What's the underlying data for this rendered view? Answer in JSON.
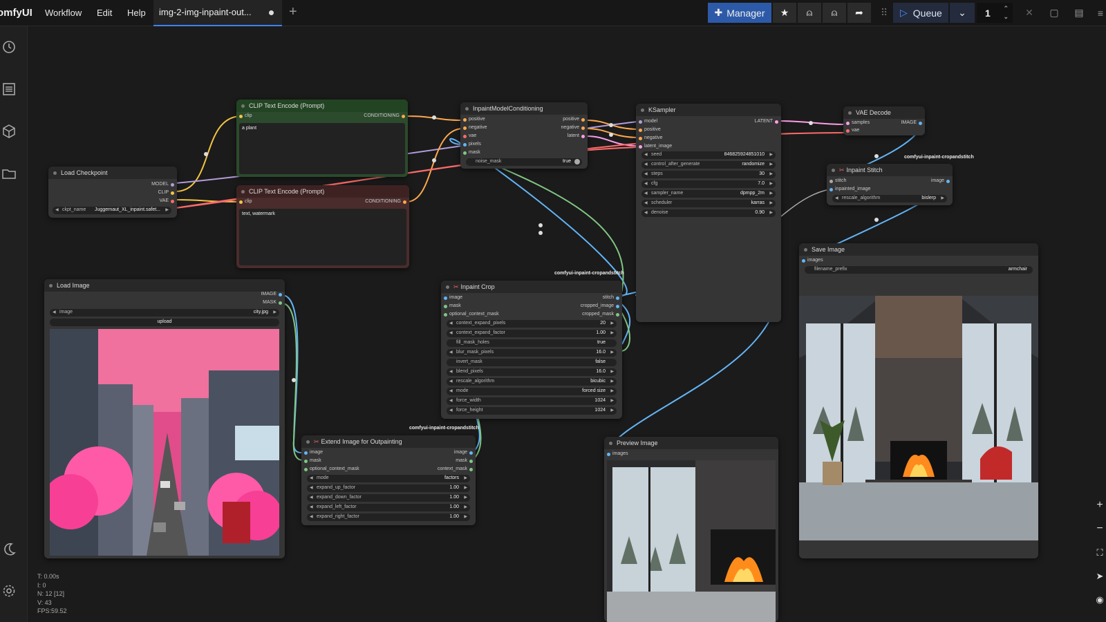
{
  "topbar": {
    "logo": "omfyUI",
    "menu": [
      "Workflow",
      "Edit",
      "Help"
    ],
    "tab_title": "img-2-img-inpaint-out...",
    "manager_label": "Manager",
    "queue_label": "Queue",
    "queue_count": "1"
  },
  "nodes": {
    "clip_pos": {
      "title": "CLIP Text Encode (Prompt)",
      "in": "clip",
      "out": "CONDITIONING",
      "text": "a plant"
    },
    "clip_neg": {
      "title": "CLIP Text Encode (Prompt)",
      "in": "clip",
      "out": "CONDITIONING",
      "text": "text, watermark"
    },
    "checkpoint": {
      "title": "Load Checkpoint",
      "outs": [
        "MODEL",
        "CLIP",
        "VAE"
      ],
      "w_label": "ckpt_name",
      "w_value": "Juggernaut_XL_inpaint.safet..."
    },
    "inpaint_cond": {
      "title": "InpaintModelConditioning",
      "ins": [
        "positive",
        "negative",
        "vae",
        "pixels",
        "mask"
      ],
      "outs": [
        "positive",
        "negative",
        "latent"
      ],
      "w_label": "noise_mask",
      "w_value": "true"
    },
    "ksampler": {
      "title": "KSampler",
      "ins": [
        "model",
        "positive",
        "negative",
        "latent_image"
      ],
      "out": "LATENT",
      "widgets": [
        [
          "seed",
          "846825924851010"
        ],
        [
          "control_after_generate",
          "randomize"
        ],
        [
          "steps",
          "30"
        ],
        [
          "cfg",
          "7.0"
        ],
        [
          "sampler_name",
          "dpmpp_2m"
        ],
        [
          "scheduler",
          "karras"
        ],
        [
          "denoise",
          "0.90"
        ]
      ]
    },
    "vae_decode": {
      "title": "VAE Decode",
      "ins": [
        "samples",
        "vae"
      ],
      "out": "IMAGE"
    },
    "inpaint_stitch": {
      "title": "Inpaint Stitch",
      "badge": "comfyui-inpaint-cropandstitch",
      "ins": [
        "stitch",
        "inpainted_image"
      ],
      "out": "image",
      "w_label": "rescale_algorithm",
      "w_value": "bislerp"
    },
    "save_image": {
      "title": "Save Image",
      "in": "images",
      "w_label": "filename_prefix",
      "w_value": "armchair"
    },
    "load_image": {
      "title": "Load Image",
      "outs": [
        "IMAGE",
        "MASK"
      ],
      "w_label": "image",
      "w_value": "city.jpg",
      "upload": "upload"
    },
    "inpaint_crop": {
      "title": "Inpaint Crop",
      "badge": "comfyui-inpaint-cropandstitch",
      "ins": [
        "image",
        "mask",
        "optional_context_mask"
      ],
      "outs": [
        "stitch",
        "cropped_image",
        "cropped_mask"
      ],
      "widgets": [
        [
          "context_expand_pixels",
          "20"
        ],
        [
          "context_expand_factor",
          "1.00"
        ],
        [
          "fill_mask_holes",
          "true"
        ],
        [
          "blur_mask_pixels",
          "16.0"
        ],
        [
          "invert_mask",
          "false"
        ],
        [
          "blend_pixels",
          "16.0"
        ],
        [
          "rescale_algorithm",
          "bicubic"
        ],
        [
          "mode",
          "forced size"
        ],
        [
          "force_width",
          "1024"
        ],
        [
          "force_height",
          "1024"
        ]
      ]
    },
    "extend": {
      "title": "Extend Image for Outpainting",
      "badge": "comfyui-inpaint-cropandstitch",
      "ins": [
        "image",
        "mask",
        "optional_context_mask"
      ],
      "outs": [
        "image",
        "mask",
        "context_mask"
      ],
      "widgets": [
        [
          "mode",
          "factors"
        ],
        [
          "expand_up_factor",
          "1.00"
        ],
        [
          "expand_down_factor",
          "1.00"
        ],
        [
          "expand_left_factor",
          "1.00"
        ],
        [
          "expand_right_factor",
          "1.00"
        ]
      ]
    },
    "preview": {
      "title": "Preview Image",
      "in": "images"
    }
  },
  "stats": [
    "T: 0.00s",
    "I: 0",
    "N: 12 [12]",
    "V: 43",
    "FPS:59.52"
  ],
  "colors": {
    "accent": "#3b82f6",
    "clip": "#f4c542",
    "model": "#b39ddb",
    "vae": "#ff6b6b",
    "image": "#64b5f6",
    "mask": "#81c784",
    "latent": "#ff9ee7",
    "conditioning": "#ffa94d"
  }
}
